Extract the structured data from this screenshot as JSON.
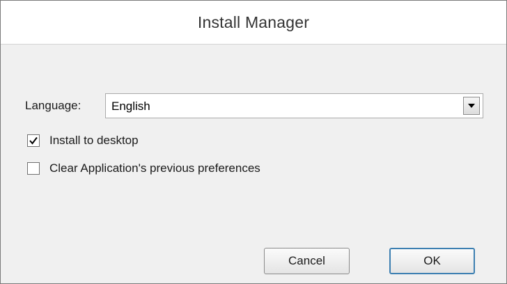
{
  "window": {
    "title": "Install Manager"
  },
  "form": {
    "language_label": "Language:",
    "language_value": "English",
    "install_desktop": {
      "label": "Install to desktop",
      "checked": true
    },
    "clear_prefs": {
      "label": "Clear Application's previous preferences",
      "checked": false
    }
  },
  "buttons": {
    "cancel_label": "Cancel",
    "ok_label": "OK"
  },
  "icons": {
    "dropdown": "chevron-down-icon",
    "checkmark": "checkmark-icon"
  }
}
